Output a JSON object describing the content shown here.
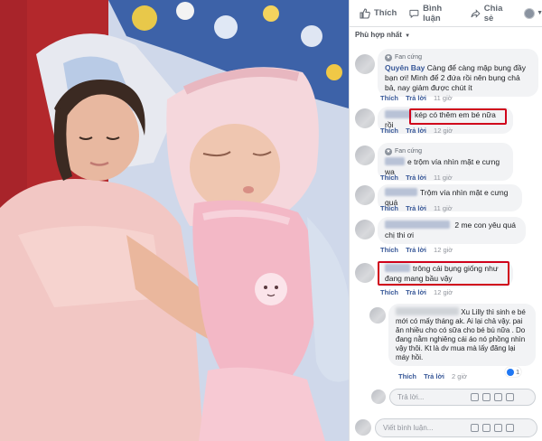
{
  "actions": {
    "like_label": "Thích",
    "comment_label": "Bình luận",
    "share_label": "Chia sẻ"
  },
  "sort": {
    "label": "Phù hợp nhất"
  },
  "comments": [
    {
      "badge": "Fan cứng",
      "name": "Quyên Bay",
      "text": "Càng để càng mập bụng đầy bạn ơi! Mình để 2 đứa rồi nên bụng chả bả, nay giảm được chút ít",
      "like": "Thích",
      "reply": "Trả lời",
      "time": "11 giờ"
    },
    {
      "text": "kép có thêm em bé nữa rồi",
      "like": "Thích",
      "reply": "Trả lời",
      "time": "12 giờ"
    },
    {
      "badge": "Fan cứng",
      "text": "e trộm vía nhìn mặt e cưng wa",
      "like": "Thích",
      "reply": "Trả lời",
      "time": "11 giờ"
    },
    {
      "text": "Trộm vía nhìn mặt e cưng quá",
      "like": "Thích",
      "reply": "Trả lời",
      "time": "11 giờ"
    },
    {
      "text": "2 me con yêu quá chị thi ơi",
      "like": "Thích",
      "reply": "Trả lời",
      "time": "12 giờ"
    },
    {
      "text": "trông cái bụng giống như đang mang bầu vậy",
      "like": "Thích",
      "reply": "Trả lời",
      "time": "12 giờ"
    },
    {
      "text": "Xu Lilly thì sinh e bé mới có mấy tháng ak. Ai lại chả vậy. pai ăn nhiều cho có sữa cho bé bú nữa . Do đang nằm nghiêng cái áo nó phồng nhìn vậy thôi. Kt là dv mua mà lấy đăng lại máy hồi.",
      "like": "Thích",
      "reply": "Trả lời",
      "time": "2 giờ",
      "like_count": "1"
    }
  ],
  "reply_placeholder": "Trả lời...",
  "comment_placeholder": "Viết bình luận...",
  "colors": {
    "link": "#385898",
    "bubble": "#f2f3f5",
    "highlight": "#d0021b"
  }
}
